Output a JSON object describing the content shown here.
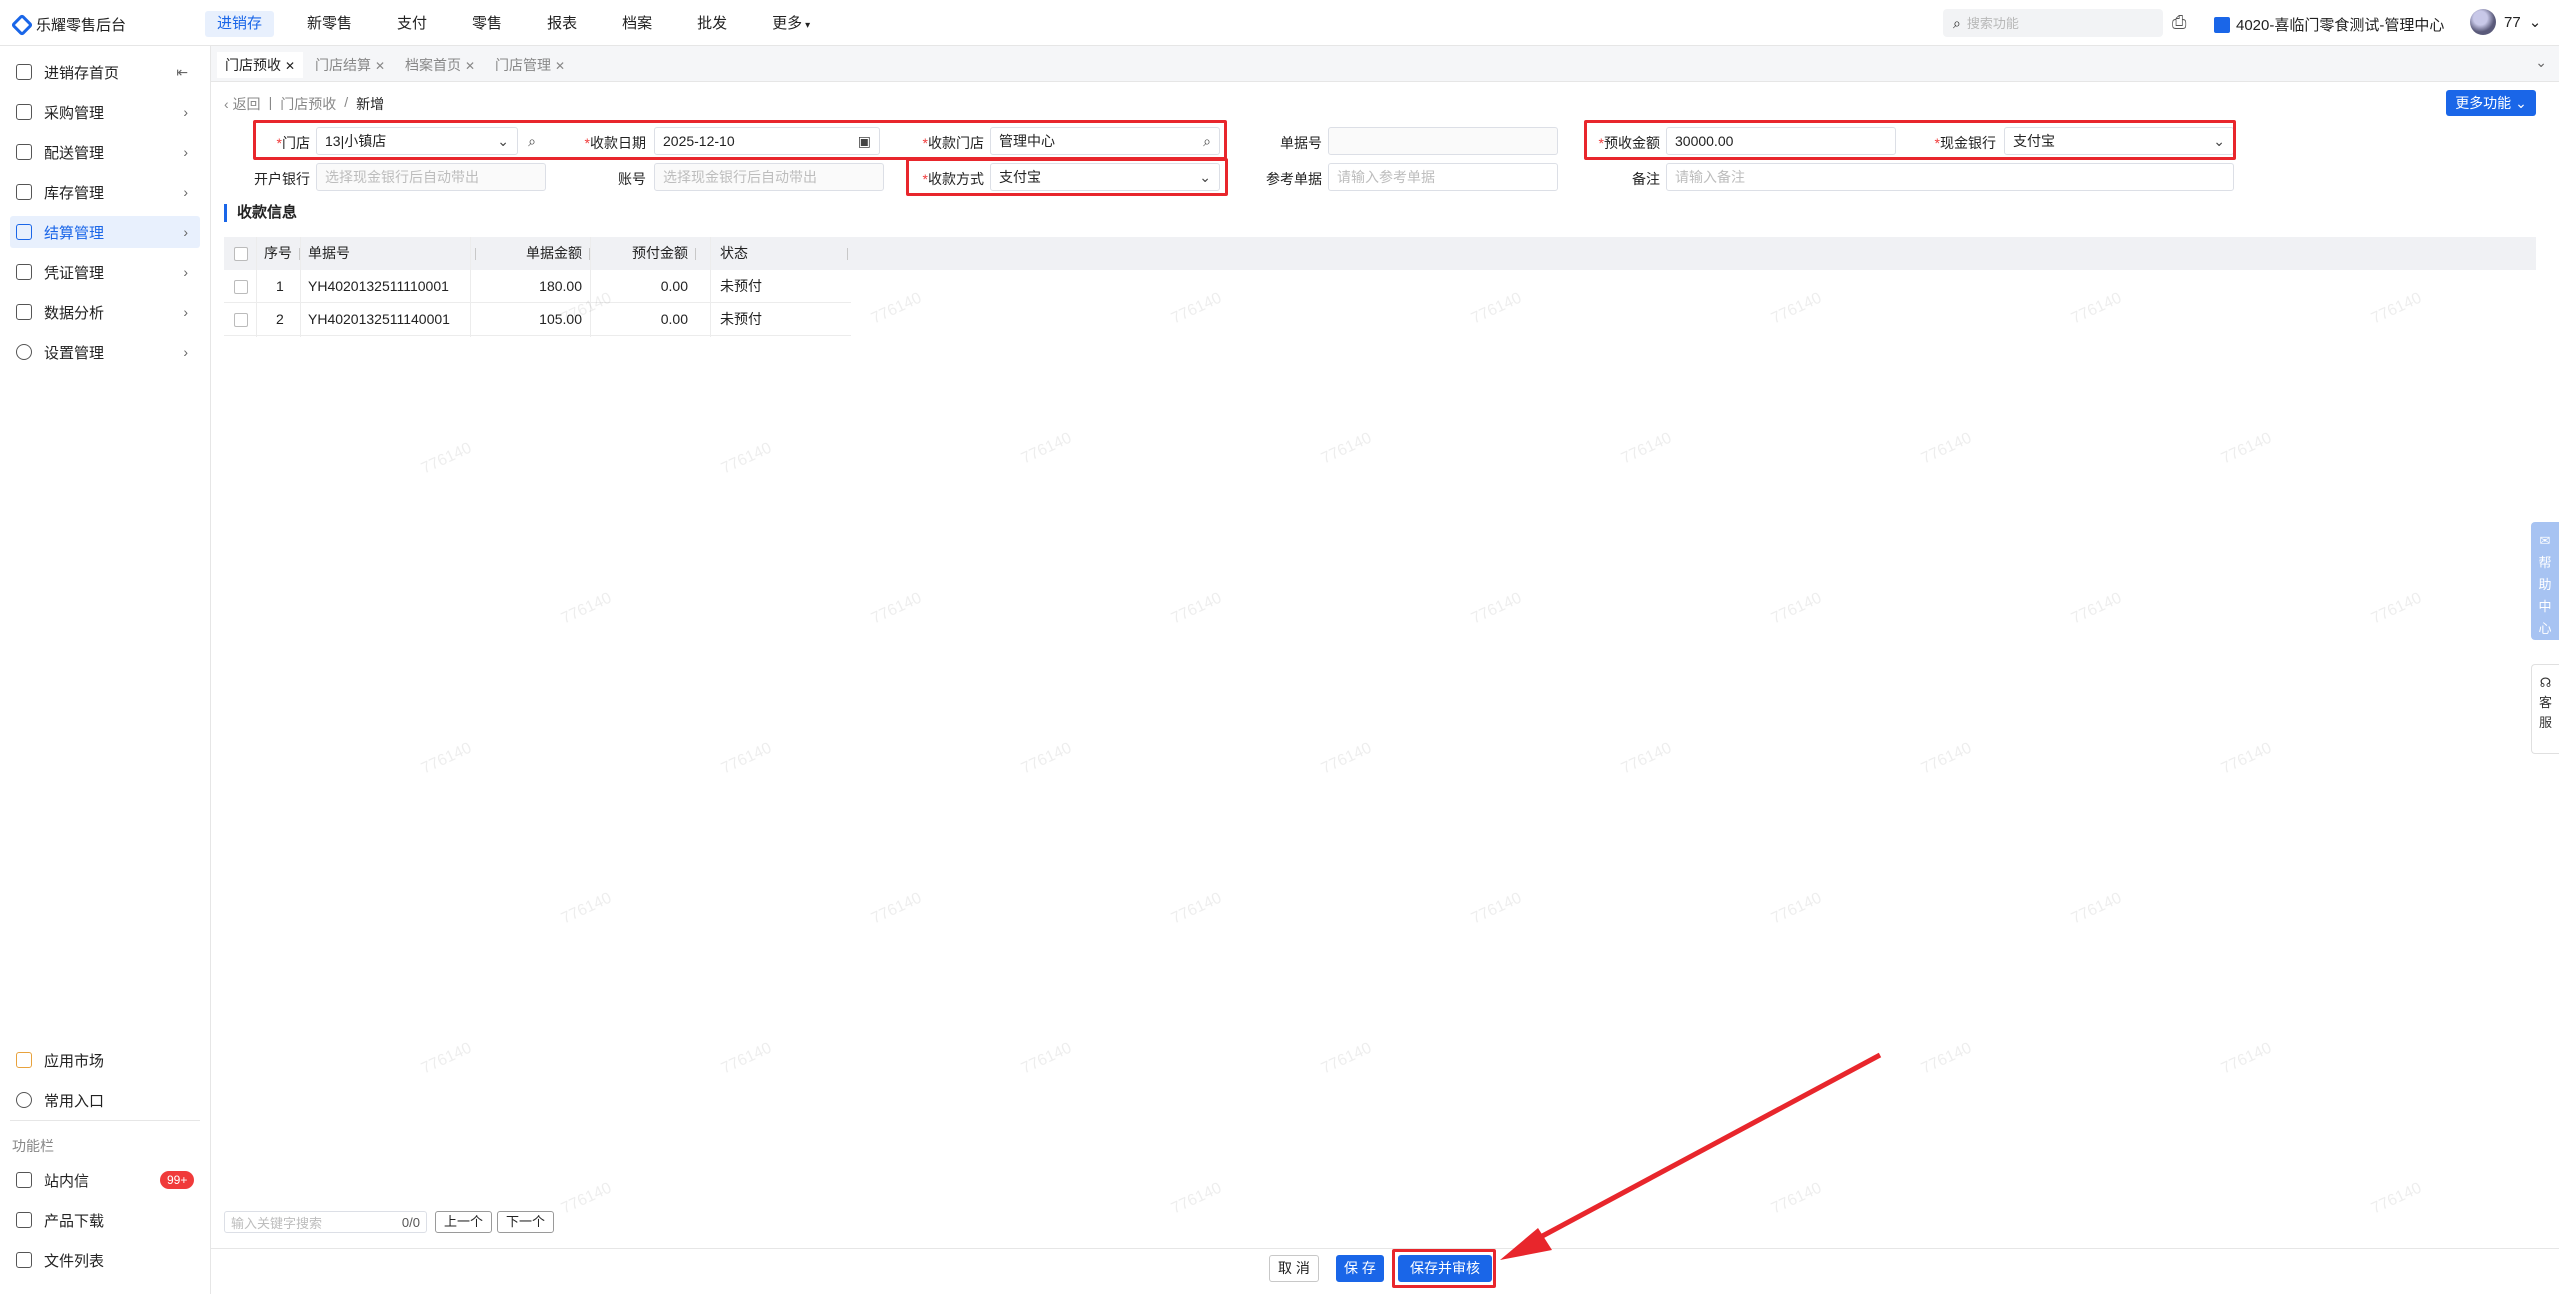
{
  "app": {
    "title": "乐耀零售后台"
  },
  "topnav": {
    "items": [
      "进销存",
      "新零售",
      "支付",
      "零售",
      "报表",
      "档案",
      "批发",
      "更多"
    ],
    "active_index": 0
  },
  "search": {
    "placeholder": "搜索功能"
  },
  "company": "4020-喜临门零食测试-管理中心",
  "user": "77",
  "sidebar": {
    "items": [
      "进销存首页",
      "采购管理",
      "配送管理",
      "库存管理",
      "结算管理",
      "凭证管理",
      "数据分析",
      "设置管理"
    ],
    "active_index": 4,
    "bottom_items": [
      "应用市场",
      "常用入口"
    ],
    "section_label": "功能栏",
    "func_items": [
      "站内信",
      "产品下载",
      "文件列表"
    ],
    "badge": "99+"
  },
  "tabs": [
    "门店预收",
    "门店结算",
    "档案首页",
    "门店管理"
  ],
  "breadcrumb": {
    "back": "返回",
    "parent": "门店预收",
    "current": "新增"
  },
  "more_button": "更多功能",
  "form": {
    "store_label": "门店",
    "store_value": "13|小镇店",
    "date_label": "收款日期",
    "date_value": "2025-12-10",
    "recv_store_label": "收款门店",
    "recv_store_value": "管理中心",
    "doc_no_label": "单据号",
    "doc_no_placeholder": "",
    "prepay_label": "预收金额",
    "prepay_value": "30000.00",
    "cash_bank_label": "现金银行",
    "cash_bank_value": "支付宝",
    "open_bank_label": "开户银行",
    "open_bank_placeholder": "选择现金银行后自动带出",
    "account_label": "账号",
    "account_placeholder": "选择现金银行后自动带出",
    "pay_method_label": "收款方式",
    "pay_method_value": "支付宝",
    "ref_doc_label": "参考单据",
    "ref_doc_placeholder": "请输入参考单据",
    "remark_label": "备注",
    "remark_placeholder": "请输入备注"
  },
  "section_title": "收款信息",
  "table": {
    "headers": [
      "序号",
      "单据号",
      "单据金额",
      "预付金额",
      "状态"
    ],
    "rows": [
      {
        "no": "1",
        "doc": "YH4020132511110001",
        "amount": "180.00",
        "prepaid": "0.00",
        "status": "未预付"
      },
      {
        "no": "2",
        "doc": "YH4020132511140001",
        "amount": "105.00",
        "prepaid": "0.00",
        "status": "未预付"
      }
    ]
  },
  "bottom": {
    "kw_placeholder": "输入关键字搜索",
    "kw_count": "0/0",
    "prev": "上一个",
    "next": "下一个"
  },
  "footer": {
    "cancel": "取 消",
    "save": "保 存",
    "save_audit": "保存并审核"
  },
  "help": {
    "help_label": "帮助中心",
    "cs_label": "客服"
  },
  "watermark": "776140",
  "colors": {
    "primary": "#1a66e8",
    "highlight": "#e8262c",
    "badge": "#f03a3a"
  }
}
